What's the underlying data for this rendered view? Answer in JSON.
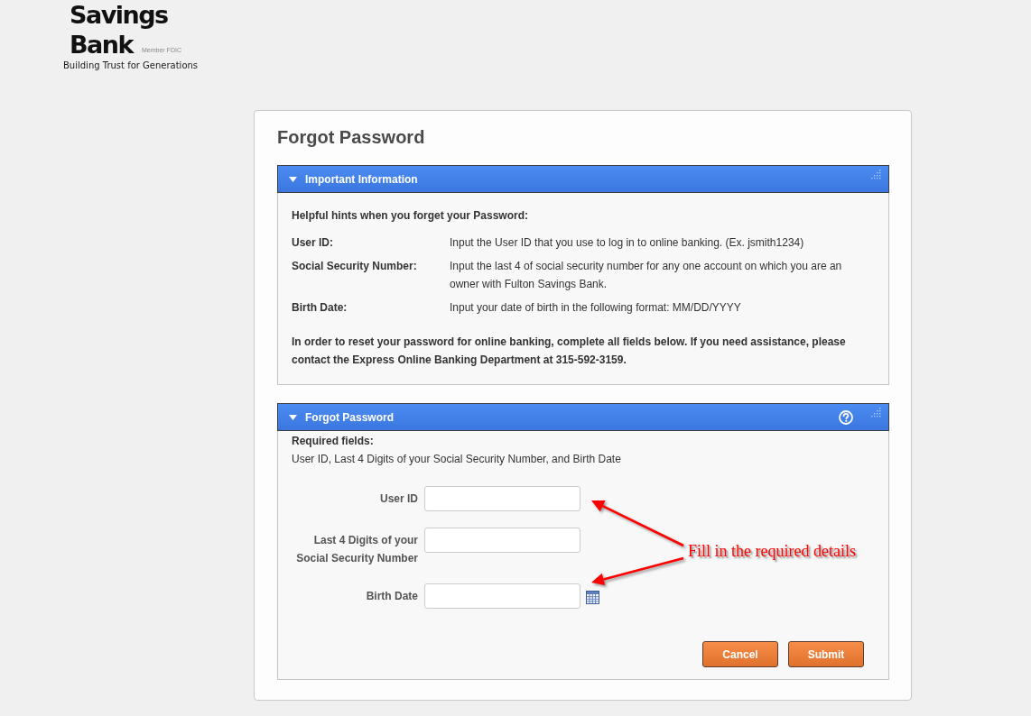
{
  "logo": {
    "wordmark": [
      "Savings",
      "Bank"
    ],
    "member": "Member FDIC",
    "tagline": "Building Trust for Generations"
  },
  "page_title": "Forgot Password",
  "panels": [
    {
      "kind": "info",
      "title": "Important Information",
      "expanded": true,
      "intro": "Helpful hints when you forget your Password:",
      "hints": [
        {
          "label": "User ID:",
          "text": "Input the User ID that you use to log in to online banking. (Ex. jsmith1234)"
        },
        {
          "label": "Social Security Number:",
          "text": "Input the last 4 of social security number for any one account on which you are an owner with Fulton Savings Bank."
        },
        {
          "label": "Birth Date:",
          "text": "Input your date of birth in the following format: MM/DD/YYYY"
        }
      ],
      "note": "In order to reset your password for online banking, complete all fields below. If you need assistance, please contact the Express Online Banking Department at 315-592-3159."
    },
    {
      "kind": "form",
      "title": "Forgot Password",
      "expanded": true,
      "required_heading": "Required fields:",
      "required_list": "User ID, Last 4 Digits of your Social Security Number, and Birth Date",
      "fields": [
        {
          "kind": "text",
          "label": "User ID"
        },
        {
          "kind": "text",
          "label": "Last 4 Digits of your Social Security Number"
        },
        {
          "kind": "date",
          "label": "Birth Date"
        }
      ],
      "buttons": [
        "Cancel",
        "Submit"
      ],
      "annotation": {
        "text": "Fill in the required details"
      }
    }
  ]
}
